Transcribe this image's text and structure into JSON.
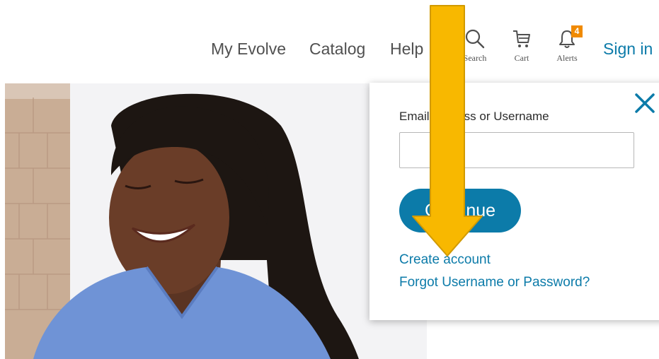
{
  "nav": {
    "my_evolve": "My Evolve",
    "catalog": "Catalog",
    "help": "Help",
    "search_label": "Search",
    "cart_label": "Cart",
    "alerts_label": "Alerts",
    "alerts_count": "4",
    "sign_in": "Sign in"
  },
  "colors": {
    "brand_blue": "#0c7ba9",
    "badge_orange": "#f08a00",
    "annotation_arrow": "#f8b800"
  },
  "icons": {
    "search": "search-icon",
    "cart": "cart-icon",
    "alerts": "bell-icon",
    "close": "close-icon"
  },
  "signin_popup": {
    "email_label": "Email Address or Username",
    "email_value": "",
    "continue_label": "Continue",
    "create_account": "Create account",
    "forgot": "Forgot Username or Password?"
  }
}
